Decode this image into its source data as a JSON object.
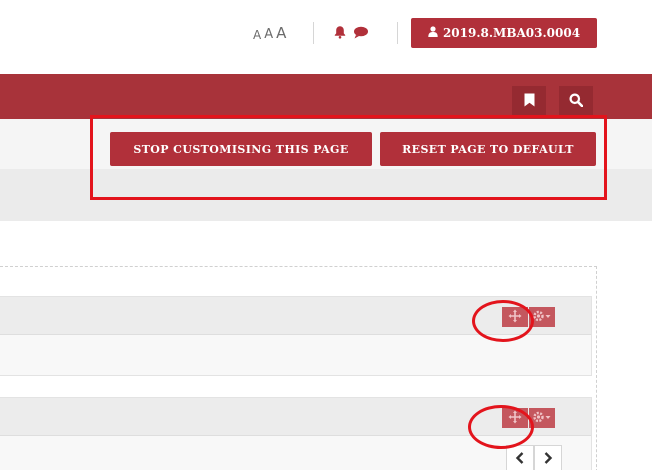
{
  "header": {
    "font_size_labels": [
      "A",
      "A",
      "A"
    ],
    "user_button_label": "2019.8.MBA03.0004",
    "icons": [
      "bell-icon",
      "chat-icon",
      "user-icon"
    ]
  },
  "navbar": {
    "icons": [
      "bookmark-icon",
      "search-icon"
    ]
  },
  "customise": {
    "stop_label": "STOP CUSTOMISING THIS PAGE",
    "reset_label": "RESET PAGE TO DEFAULT"
  },
  "panels": [
    {
      "tools": [
        "move-icon",
        "gear-icon"
      ]
    },
    {
      "tools": [
        "move-icon",
        "gear-icon"
      ]
    }
  ],
  "pager": {
    "icons": [
      "chevron-left-icon",
      "chevron-right-icon"
    ]
  },
  "colors": {
    "brand_red": "#b1303a",
    "nav_red": "#a8333a",
    "annotation_red": "#e3141c"
  }
}
